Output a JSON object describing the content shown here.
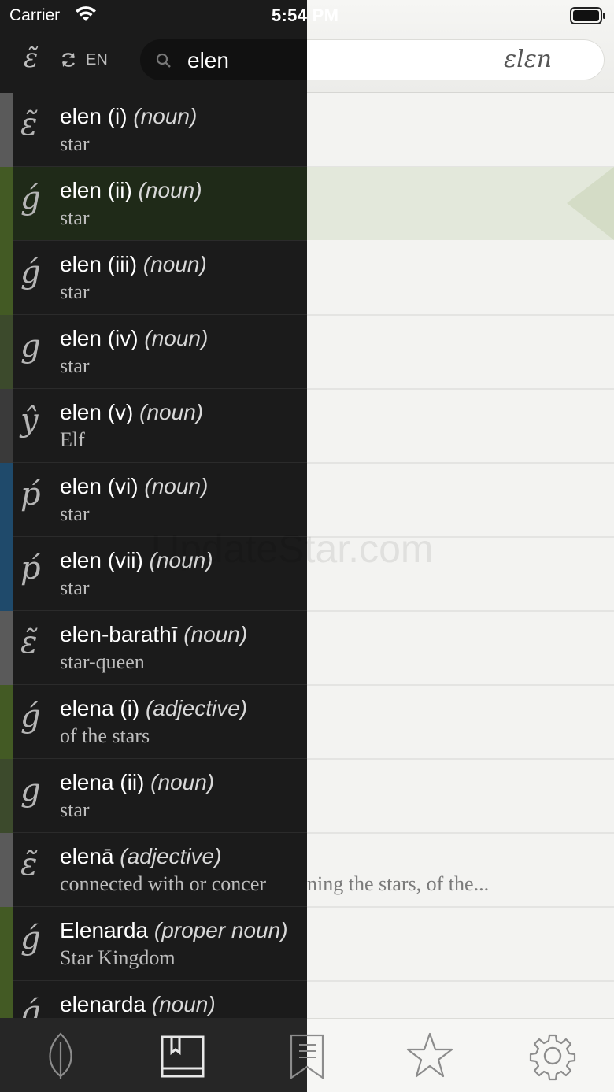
{
  "status_bar": {
    "carrier": "Carrier",
    "time": "5:54 PM"
  },
  "search": {
    "language": "EN",
    "query": "elen",
    "tengwar_transcription": "ɛlɛn"
  },
  "results": [
    {
      "title": "elen (i)",
      "pos": "(noun)",
      "gloss": "star",
      "stripe": "#5a5a5a"
    },
    {
      "title": "elen (ii)",
      "pos": "(noun)",
      "gloss": "star",
      "stripe": "#435a24"
    },
    {
      "title": "elen (iii)",
      "pos": "(noun)",
      "gloss": "star",
      "stripe": "#435a24"
    },
    {
      "title": "elen (iv)",
      "pos": "(noun)",
      "gloss": "star",
      "stripe": "#3c4a2c"
    },
    {
      "title": "elen (v)",
      "pos": "(noun)",
      "gloss": "Elf",
      "stripe": "#3a3a3a"
    },
    {
      "title": "elen (vi)",
      "pos": "(noun)",
      "gloss": "star",
      "stripe": "#1f4a6b"
    },
    {
      "title": "elen (vii)",
      "pos": "(noun)",
      "gloss": "star",
      "stripe": "#1f4a6b"
    },
    {
      "title": "elen-barathī",
      "pos": "(noun)",
      "gloss": "star-queen",
      "stripe": "#5a5a5a"
    },
    {
      "title": "elena (i)",
      "pos": "(adjective)",
      "gloss": "of the stars",
      "stripe": "#435a24"
    },
    {
      "title": "elena (ii)",
      "pos": "(noun)",
      "gloss": "star",
      "stripe": "#3c4a2c"
    },
    {
      "title": "elenā",
      "pos": "(adjective)",
      "gloss": "connected with or concer",
      "stripe": "#5a5a5a"
    },
    {
      "title": "Elenarda",
      "pos": "(proper noun)",
      "gloss": "Star Kingdom",
      "stripe": "#435a24"
    },
    {
      "title": "elenarda",
      "pos": "(noun)",
      "gloss": "",
      "stripe": "#435a24"
    }
  ],
  "long_gloss_overflow": "ning the stars, of the...",
  "watermark": "UpdateStar.com",
  "tabs": [
    {
      "name": "tab-leaf",
      "icon": "leaf-icon"
    },
    {
      "name": "tab-dictionary",
      "icon": "book-icon"
    },
    {
      "name": "tab-bookmarks",
      "icon": "bookmark-icon"
    },
    {
      "name": "tab-favorites",
      "icon": "star-icon"
    },
    {
      "name": "tab-settings",
      "icon": "gear-icon"
    }
  ],
  "colors": {
    "drawer_bg": "#1b1b1b",
    "selected_row": "#1f2a18",
    "right_pane": "#f3f3f1"
  }
}
